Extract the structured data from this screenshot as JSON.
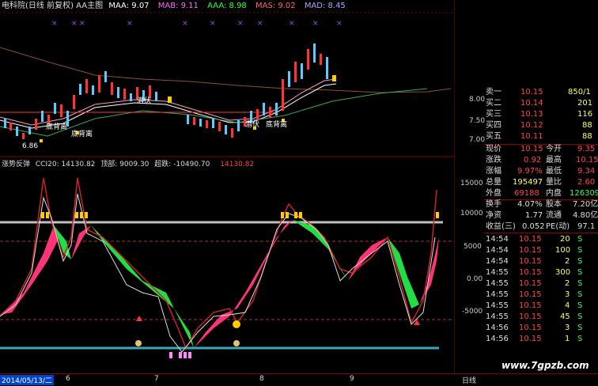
{
  "header": {
    "title": "电科院(日线 前复权) AA主图",
    "indicators": [
      {
        "label": "MAA: 9.07",
        "color": "#ffffff"
      },
      {
        "label": "MAB: 9.11",
        "color": "#ff66ff"
      },
      {
        "label": "AAA: 8.98",
        "color": "#33ff33"
      },
      {
        "label": "MAS: 9.02",
        "color": "#ff6666"
      },
      {
        "label": "MAD: 8.45",
        "color": "#aaaaff"
      }
    ]
  },
  "price_axis": [
    "8.00",
    "7.50",
    "7.00"
  ],
  "price_annotations": {
    "low_label": "6.86",
    "labels": [
      "底背离",
      "底背离",
      "潜伏",
      "潜伏",
      "底背离"
    ]
  },
  "sub_header": {
    "name": "涨势反弹",
    "cci": "CCI20: 14130.82",
    "top": "顶部: 9009.30",
    "oversold": "超跌: -10490.70",
    "value": "14130.82"
  },
  "cci_axis": [
    "15000",
    "10000",
    "5000",
    "0.00",
    "-5000"
  ],
  "x_axis": {
    "date": "2014/05/13/二",
    "ticks": [
      "6",
      "7",
      "8",
      "9"
    ],
    "period": "日线"
  },
  "order_book": [
    {
      "label": "卖一",
      "price": "10.15",
      "vol": "850/1"
    },
    {
      "label": "买二",
      "price": "10.14",
      "vol": "201"
    },
    {
      "label": "买三",
      "price": "10.13",
      "vol": "116"
    },
    {
      "label": "买四",
      "price": "10.12",
      "vol": "88"
    },
    {
      "label": "买五",
      "price": "10.11",
      "vol": "88"
    }
  ],
  "stats": [
    {
      "k1": "现价",
      "v1": "10.15",
      "k2": "今开",
      "v2": "9.35"
    },
    {
      "k1": "涨跌",
      "v1": "0.92",
      "k2": "最高",
      "v2": "10.15"
    },
    {
      "k1": "涨幅",
      "v1": "9.97%",
      "k2": "最低",
      "v2": "9.34"
    },
    {
      "k1": "总量",
      "v1": "195497",
      "k2": "量比",
      "v2": "2.60"
    },
    {
      "k1": "外盘",
      "v1": "69188",
      "k2": "内盘",
      "v2": "126309"
    },
    {
      "k1": "换手",
      "v1": "4.07%",
      "k2": "股本",
      "v2": "7.20亿"
    },
    {
      "k1": "净资",
      "v1": "1.77",
      "k2": "流通",
      "v2": "4.80亿"
    },
    {
      "k1": "收益(三)",
      "v1": "0.052",
      "k2": "PE(动)",
      "v2": "97.1"
    }
  ],
  "ticks": [
    {
      "time": "14:54",
      "price": "10.15",
      "vol": "20",
      "side": "S"
    },
    {
      "time": "14:54",
      "price": "10.15",
      "vol": "100",
      "side": "S"
    },
    {
      "time": "14:54",
      "price": "10.15",
      "vol": "2",
      "side": "S"
    },
    {
      "time": "14:55",
      "price": "10.15",
      "vol": "300",
      "side": "S"
    },
    {
      "time": "14:55",
      "price": "10.15",
      "vol": "2",
      "side": "S"
    },
    {
      "time": "14:55",
      "price": "10.15",
      "vol": "3",
      "side": "S"
    },
    {
      "time": "14:55",
      "price": "10.15",
      "vol": "4",
      "side": "S"
    },
    {
      "time": "14:55",
      "price": "10.15",
      "vol": "45",
      "side": "S"
    },
    {
      "time": "14:56",
      "price": "10.15",
      "vol": "3",
      "side": "S"
    },
    {
      "time": "14:56",
      "price": "10.15",
      "vol": "1",
      "side": "S"
    }
  ],
  "footer": {
    "watermark": "www.7gpzb.com"
  }
}
